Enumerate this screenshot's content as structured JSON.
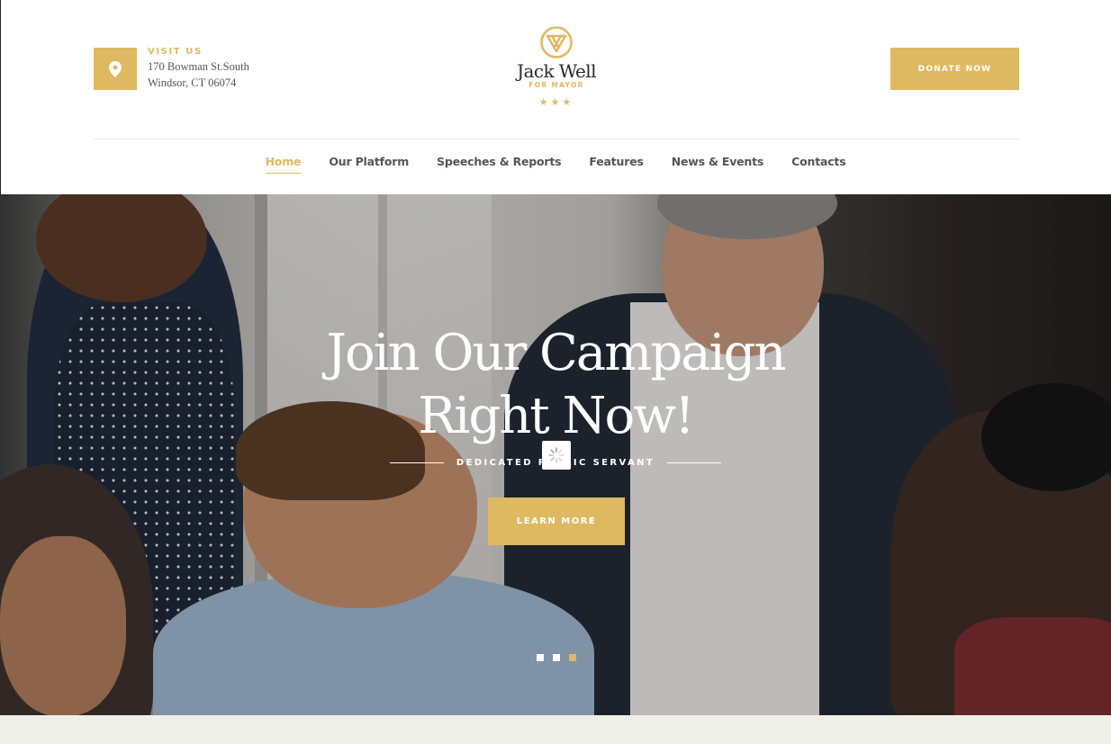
{
  "header": {
    "visit_label": "VISIT US",
    "address_line1": "170 Bowman St.South",
    "address_line2": "Windsor, CT 06074",
    "logo_name": "Jack Well",
    "logo_sub": "FOR MAYOR",
    "logo_stars": "★★★",
    "donate_label": "DONATE NOW"
  },
  "nav": {
    "items": [
      {
        "label": "Home",
        "active": true
      },
      {
        "label": "Our Platform"
      },
      {
        "label": "Speeches & Reports"
      },
      {
        "label": "Features"
      },
      {
        "label": "News & Events"
      },
      {
        "label": "Contacts"
      }
    ]
  },
  "hero": {
    "title_line1": "Join Our Campaign",
    "title_line2": "Right Now!",
    "subtitle": "DEDICATED PUBLIC SERVANT",
    "cta_label": "LEARN MORE",
    "slide_count": 3,
    "active_slide": 3
  },
  "colors": {
    "accent": "#dfb862",
    "text_dark": "#2a2a2a",
    "nav_text": "#555555"
  },
  "icons": {
    "pin": "map-pin-icon",
    "logo": "shield-logo-icon",
    "loader": "loading-spinner-icon"
  }
}
